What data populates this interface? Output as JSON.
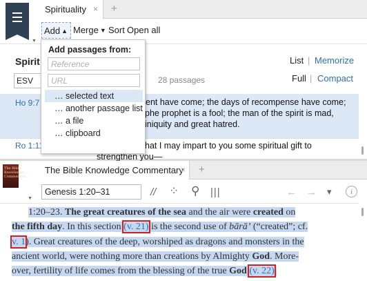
{
  "top": {
    "tab": {
      "label": "Spirituality",
      "close": "×",
      "add": "+"
    },
    "toolbar": {
      "add": "Add",
      "merge": "Merge",
      "sort": "Sort",
      "open_all": "Open all"
    },
    "list": {
      "title": "Spirit",
      "view_list": "List",
      "separator": "|",
      "memorize": "Memorize",
      "version": "ESV",
      "count": "28 passages",
      "full": "Full",
      "compact": "Compact"
    },
    "passages": [
      {
        "ref": "Ho 9:7",
        "lines": [
          "ent have come; the days of recompense have come;",
          "phe prophet is a fool; the man of the spirit is mad,",
          "iniquity and great hatred."
        ]
      },
      {
        "ref": "Ro 1:11",
        "lines": [
          "hat I may impart to you some spiritual gift to",
          "strengthen you—"
        ]
      }
    ],
    "dropdown": {
      "heading": "Add passages from:",
      "reference_placeholder": "Reference",
      "url_placeholder": "URL",
      "items": [
        "… selected text",
        "… another passage list",
        "… a file",
        "… clipboard"
      ]
    }
  },
  "bottom": {
    "book_cover_text": "The Bible Knowledge Commentary",
    "tab": {
      "label": "The Bible Knowledge Commentary",
      "close": "×",
      "add": "+"
    },
    "reference": "Genesis 1:20–31",
    "icons": {
      "parallel": "//",
      "people": "⁘",
      "search": "⚲",
      "columns": "|||",
      "back": "←",
      "forward": "→",
      "menu": "▾",
      "info": "i"
    },
    "commentary": {
      "l1": {
        "a": "1:20–23. ",
        "b": "The great creatures of the sea",
        "c": " and the air were ",
        "d": "created",
        "e": " on"
      },
      "l2": {
        "a": "the fifth day",
        "b": ". In this section ",
        "x": "(v. 21)",
        "c": " is the second use of ",
        "d": "bārā’",
        "e": " (“created”; cf."
      },
      "l3": {
        "x": "v. 1",
        "a": "). Great creatures of the deep, worshiped as dragons and monsters in the"
      },
      "l4": {
        "a": "ancient world, were nothing more than creations by Almighty ",
        "b": "God",
        "c": ". More-"
      },
      "l5": {
        "a": "over, fertility of life comes from the blessing of the true ",
        "b": "God",
        "x": "(v. 22)",
        "c": "."
      }
    }
  }
}
